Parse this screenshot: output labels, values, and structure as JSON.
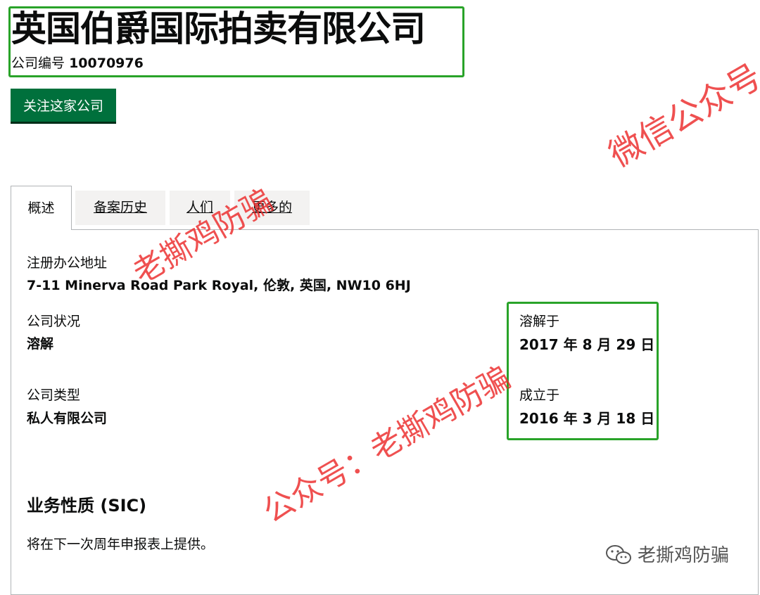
{
  "company": {
    "name": "英国伯爵国际拍卖有限公司",
    "number_label": "公司编号",
    "number": "10070976",
    "follow_label": "关注这家公司"
  },
  "tabs": [
    {
      "label": "概述",
      "active": true
    },
    {
      "label": "备案历史",
      "active": false
    },
    {
      "label": "人们",
      "active": false
    },
    {
      "label": "更多的",
      "active": false
    }
  ],
  "overview": {
    "office_label": "注册办公地址",
    "office_address": "7-11 Minerva Road Park Royal, 伦敦, 英国, NW10 6HJ",
    "status_label": "公司状况",
    "status": "溶解",
    "dissolved_label": "溶解于",
    "dissolved_date": "2017 年 8 月 29 日",
    "type_label": "公司类型",
    "type": "私人有限公司",
    "incorporated_label": "成立于",
    "incorporated_date": "2016 年 3 月 18 日",
    "sic_heading": "业务性质 (SIC)",
    "sic_text": "将在下一次周年申报表上提供。"
  },
  "watermarks": {
    "wechat": "微信公众号",
    "brand": "老撕鸡防骗",
    "public_account": "公众号：老撕鸡防骗"
  },
  "colors": {
    "highlight": "#29a329",
    "button": "#00703c",
    "watermark": "#ec2a2a",
    "tab_inactive": "#f3f2f1",
    "panel_border": "#b1b4b6"
  },
  "icons": {
    "brand": "wechat-icon"
  }
}
